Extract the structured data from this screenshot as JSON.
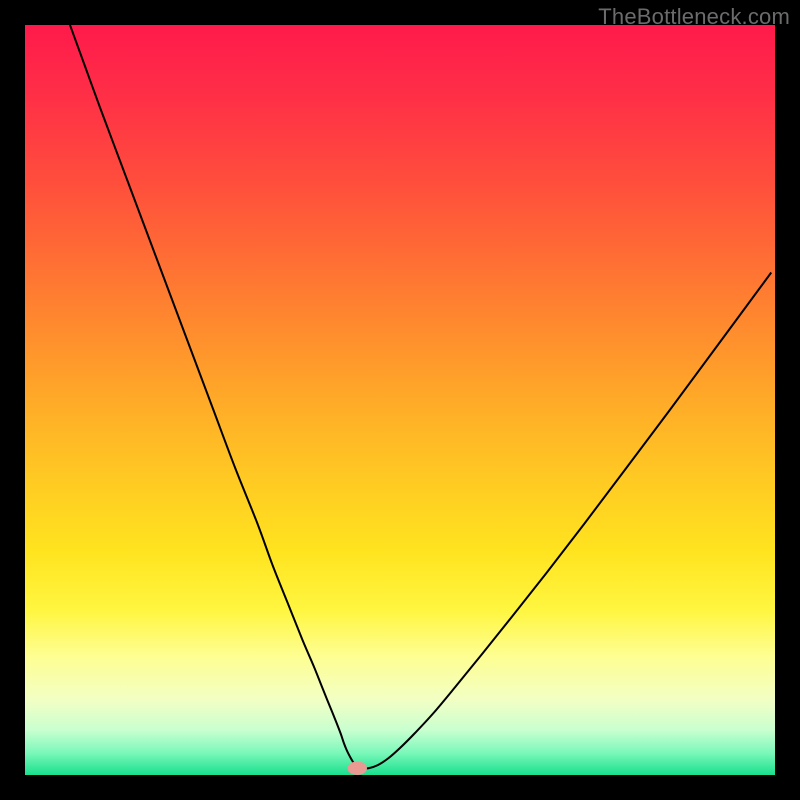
{
  "watermark": "TheBottleneck.com",
  "chart_data": {
    "type": "line",
    "title": "",
    "xlabel": "",
    "ylabel": "",
    "xlim": [
      0,
      100
    ],
    "ylim": [
      0,
      100
    ],
    "background_gradient": {
      "stops": [
        {
          "offset": 0.0,
          "color": "#ff1a4b"
        },
        {
          "offset": 0.09,
          "color": "#ff2e47"
        },
        {
          "offset": 0.2,
          "color": "#ff4b3d"
        },
        {
          "offset": 0.3,
          "color": "#ff6a35"
        },
        {
          "offset": 0.4,
          "color": "#ff8a2e"
        },
        {
          "offset": 0.5,
          "color": "#ffaa28"
        },
        {
          "offset": 0.6,
          "color": "#ffc823"
        },
        {
          "offset": 0.7,
          "color": "#ffe31f"
        },
        {
          "offset": 0.78,
          "color": "#fff640"
        },
        {
          "offset": 0.84,
          "color": "#fefe90"
        },
        {
          "offset": 0.9,
          "color": "#f2ffc4"
        },
        {
          "offset": 0.94,
          "color": "#c9ffd0"
        },
        {
          "offset": 0.97,
          "color": "#7cf8ba"
        },
        {
          "offset": 1.0,
          "color": "#19e08e"
        }
      ]
    },
    "series": [
      {
        "name": "curve",
        "color": "#000000",
        "x": [
          6,
          8,
          10,
          13,
          16,
          19,
          22,
          25,
          28,
          31,
          33,
          35,
          37,
          38.5,
          39.5,
          40.3,
          41.0,
          41.6,
          42.1,
          42.5,
          42.9,
          43.3,
          43.7,
          44.1,
          44.8,
          45.8,
          47.0,
          48.4,
          50.0,
          52.0,
          54.5,
          57.5,
          61.0,
          65.0,
          69.5,
          74.5,
          80.0,
          86.0,
          92.5,
          99.5
        ],
        "values": [
          100,
          94.5,
          89.0,
          81.0,
          73.0,
          65.0,
          57.0,
          49.0,
          41.0,
          33.5,
          28.0,
          23.0,
          18.0,
          14.5,
          12.0,
          10.0,
          8.3,
          6.8,
          5.5,
          4.3,
          3.3,
          2.5,
          1.8,
          1.3,
          0.9,
          0.9,
          1.3,
          2.2,
          3.6,
          5.6,
          8.3,
          11.9,
          16.2,
          21.2,
          26.9,
          33.4,
          40.7,
          48.7,
          57.5,
          67.0
        ]
      }
    ],
    "marker": {
      "x": 44.3,
      "y": 0.9,
      "color": "#e89a93",
      "rx": 1.3,
      "ry": 0.9
    }
  }
}
